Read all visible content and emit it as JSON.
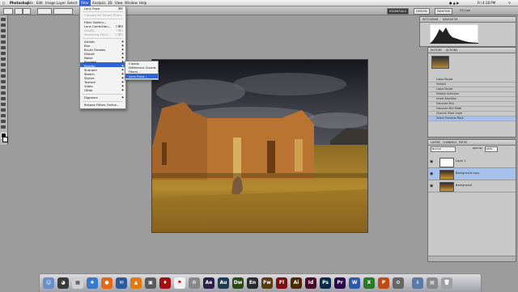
{
  "menubar": {
    "app": "Photoshop",
    "items": [
      "File",
      "Edit",
      "Image",
      "Layer",
      "Select",
      "Filter",
      "Analysis",
      "3D",
      "View",
      "Window",
      "Help"
    ],
    "active": "Filter",
    "clock": "Fri 4:18 PM"
  },
  "workspace": {
    "buttons": [
      "ESSENTIALS",
      "DESIGN",
      "PAINTING"
    ],
    "active": "ESSENTIALS",
    "cs_live": "CS Live"
  },
  "filter_menu": {
    "items": [
      {
        "label": "Lens Flare",
        "shortcut": "⌘F",
        "disabled": false
      },
      {
        "label": "Convert for Smart Filters",
        "shortcut": "",
        "disabled": true
      },
      {
        "label": "Filter Gallery...",
        "shortcut": "",
        "disabled": false
      },
      {
        "label": "Lens Correction...",
        "shortcut": "⇧⌘R",
        "disabled": false
      },
      {
        "label": "Liquify...",
        "shortcut": "⇧⌘X",
        "disabled": true
      },
      {
        "label": "Vanishing Point...",
        "shortcut": "⌥⌘V",
        "disabled": true
      },
      {
        "label": "Artistic",
        "submenu": true
      },
      {
        "label": "Blur",
        "submenu": true
      },
      {
        "label": "Brush Strokes",
        "submenu": true
      },
      {
        "label": "Distort",
        "submenu": true
      },
      {
        "label": "Noise",
        "submenu": true
      },
      {
        "label": "Pixelate",
        "submenu": true
      },
      {
        "label": "Render",
        "submenu": true,
        "highlighted": true
      },
      {
        "label": "Sharpen",
        "submenu": true
      },
      {
        "label": "Sketch",
        "submenu": true
      },
      {
        "label": "Stylize",
        "submenu": true
      },
      {
        "label": "Texture",
        "submenu": true
      },
      {
        "label": "Video",
        "submenu": true
      },
      {
        "label": "Other",
        "submenu": true
      },
      {
        "label": "Digimarc",
        "submenu": true
      },
      {
        "label": "Browse Filters Online..."
      }
    ]
  },
  "render_submenu": {
    "items": [
      "Clouds",
      "Difference Clouds",
      "Fibers...",
      "Lens Flare..."
    ],
    "highlighted": "Lens Flare..."
  },
  "panels": {
    "histogram_tabs": [
      "HISTOGRAM",
      "NAVIGATOR"
    ],
    "history_tabs": [
      "HISTORY",
      "ACTIONS"
    ],
    "history_items": [
      "Lasso Mouse",
      "Feather",
      "Lasso Mouse",
      "Feather Selection",
      "Invert Selection",
      "Gaussian Blur",
      "Gaussian Blur Mask",
      "Channel Mixer Layer",
      "Select Previous Mask"
    ],
    "layers_tabs": [
      "LAYERS",
      "CHANNELS",
      "PATHS"
    ],
    "blend_mode": "Normal",
    "opacity_label": "Opacity:",
    "opacity": "100%",
    "layers": [
      {
        "name": "Layer 1",
        "selected": false
      },
      {
        "name": "Background copy",
        "selected": true
      },
      {
        "name": "Background",
        "selected": false
      }
    ]
  },
  "dock": {
    "apps": [
      {
        "label": "Ae",
        "color": "#2b1f4a"
      },
      {
        "label": "Au",
        "color": "#1c3d4f"
      },
      {
        "label": "Dw",
        "color": "#2c4a16"
      },
      {
        "label": "En",
        "color": "#2a2a2a"
      },
      {
        "label": "Fw",
        "color": "#5a3a10"
      },
      {
        "label": "Fl",
        "color": "#7a1010"
      },
      {
        "label": "Ai",
        "color": "#4a2a05"
      },
      {
        "label": "Id",
        "color": "#4a0a2a"
      },
      {
        "label": "Ps",
        "color": "#0a2a4a"
      },
      {
        "label": "Pr",
        "color": "#2a0a4a"
      }
    ]
  }
}
